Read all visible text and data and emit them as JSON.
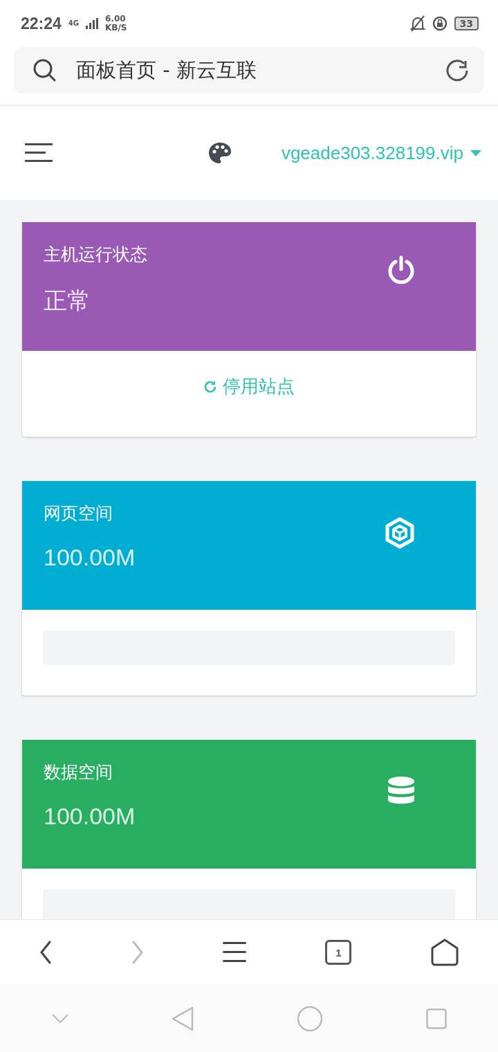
{
  "status_bar": {
    "time": "22:24",
    "network": "4G",
    "speed": "6.00",
    "speed_unit": "KB/S",
    "battery": "33"
  },
  "address_bar": {
    "title": "面板首页 - 新云互联"
  },
  "header": {
    "domain": "vgeade303.328199.vip"
  },
  "cards": [
    {
      "kind": "status",
      "title": "主机运行状态",
      "value": "正常",
      "color": "#9b59b6",
      "action": "停用站点"
    },
    {
      "kind": "web",
      "title": "网页空间",
      "value": "100.00M",
      "color": "#00aed4"
    },
    {
      "kind": "database",
      "title": "数据空间",
      "value": "100.00M",
      "color": "#27ae60"
    }
  ],
  "browser_bar": {
    "back_disabled": false,
    "forward_disabled": true,
    "tab_count": "1"
  }
}
